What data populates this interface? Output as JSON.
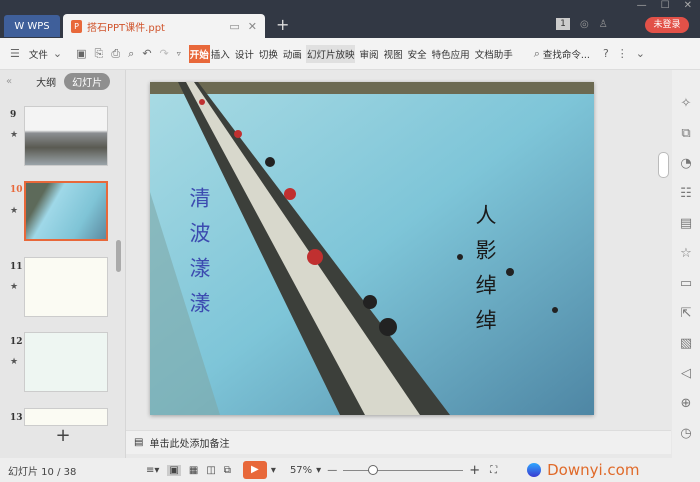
{
  "titlebar": {
    "wps_tab": "WPS",
    "doc_tab": "搭石PPT课件.ppt",
    "new_tab": "+",
    "page_badge": "1",
    "login": "未登录"
  },
  "menubar": {
    "file": "文件",
    "tabs": [
      "开始",
      "插入",
      "设计",
      "切换",
      "动画",
      "幻灯片放映",
      "审阅",
      "视图",
      "安全",
      "特色应用",
      "文档助手"
    ],
    "search": "查找命令...",
    "help": "?"
  },
  "sidebar": {
    "outline": "大纲",
    "slides": "幻灯片",
    "thumbs": [
      {
        "num": "9"
      },
      {
        "num": "10"
      },
      {
        "num": "11"
      },
      {
        "num": "12"
      },
      {
        "num": "13"
      }
    ],
    "add": "+"
  },
  "slide": {
    "left_text": "清波漾漾",
    "right_text": "人影绰绰"
  },
  "notes": {
    "placeholder": "单击此处添加备注"
  },
  "status": {
    "slide_info": "幻灯片 10 / 38",
    "zoom": "57%",
    "watermark": "Downyi.com"
  },
  "colors": {
    "accent": "#e8683a",
    "titlebar": "#323844",
    "login": "#e25148"
  }
}
